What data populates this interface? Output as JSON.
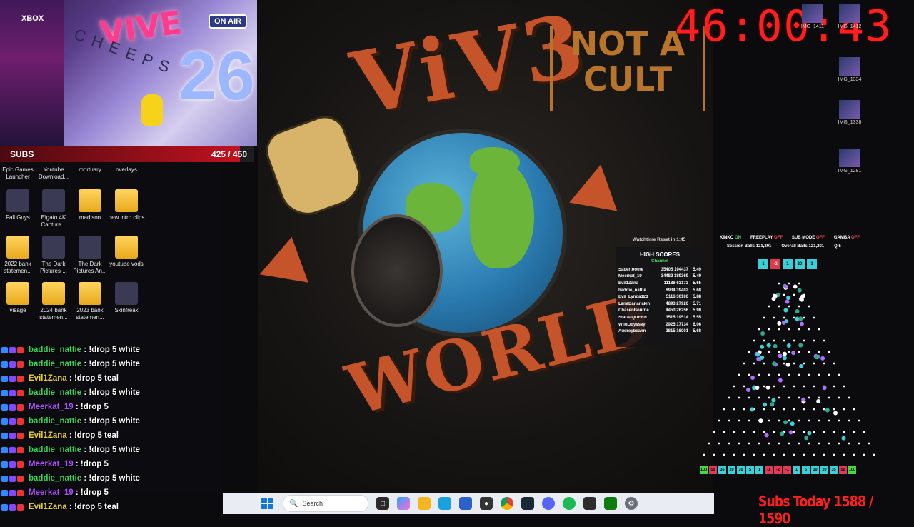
{
  "webcam": {
    "overlay_logo": "VIVE",
    "banner_text": "CHEEPS",
    "balloon_number": "26",
    "on_air": "ON AIR",
    "brand": "XBOX"
  },
  "subs_goal": {
    "label": "SUBS",
    "current": 425,
    "goal": 450,
    "count_text": "425 / 450"
  },
  "desktop_icons": [
    {
      "label": "Epic Games Launcher",
      "line2": "",
      "type": "app"
    },
    {
      "label": "Youtube Download...",
      "type": "app"
    },
    {
      "label": "mortuary",
      "type": "folder"
    },
    {
      "label": "overlays",
      "type": "folder"
    },
    {
      "label": "Fall Guys",
      "type": "app"
    },
    {
      "label": "Elgato 4K Capture...",
      "type": "app"
    },
    {
      "label": "madison",
      "type": "folder"
    },
    {
      "label": "new intro clips",
      "type": "folder"
    },
    {
      "label": "2022 bank statemen...",
      "type": "folder"
    },
    {
      "label": "The Dark Pictures ...",
      "type": "app"
    },
    {
      "label": "The Dark Pictures An...",
      "type": "app"
    },
    {
      "label": "youtube vods",
      "type": "folder"
    },
    {
      "label": "visage",
      "type": "folder"
    },
    {
      "label": "2024 bank statemen...",
      "type": "folder"
    },
    {
      "label": "2023 bank statemen...",
      "type": "folder"
    },
    {
      "label": "Skinfreak",
      "type": "app"
    }
  ],
  "chat": [
    {
      "user": "baddie_nattie",
      "msg": "!drop 5 white",
      "color": "#2fd65a"
    },
    {
      "user": "baddie_nattie",
      "msg": "!drop 5 white",
      "color": "#2fd65a"
    },
    {
      "user": "Evil1Zana",
      "msg": "!drop 5 teal",
      "color": "#e8d12a"
    },
    {
      "user": "baddie_nattie",
      "msg": "!drop 5 white",
      "color": "#2fd65a"
    },
    {
      "user": "Meerkat_19",
      "msg": "!drop 5",
      "color": "#b04dff"
    },
    {
      "user": "baddie_nattie",
      "msg": "!drop 5 white",
      "color": "#2fd65a"
    },
    {
      "user": "Evil1Zana",
      "msg": "!drop 5 teal",
      "color": "#e8d12a"
    },
    {
      "user": "baddie_nattie",
      "msg": "!drop 5 white",
      "color": "#2fd65a"
    },
    {
      "user": "Meerkat_19",
      "msg": "!drop 5",
      "color": "#b04dff"
    },
    {
      "user": "baddie_nattie",
      "msg": "!drop 5 white",
      "color": "#2fd65a"
    },
    {
      "user": "Meerkat_19",
      "msg": "!drop 5",
      "color": "#b04dff"
    },
    {
      "user": "Evil1Zana",
      "msg": "!drop 5 teal",
      "color": "#e8d12a"
    }
  ],
  "album_art": {
    "word_top": "ViV3",
    "word_bottom": "WORLD",
    "tagline_line1": "NOT A",
    "tagline_line2": "CULT"
  },
  "watchtime": "Watchtime Reset in 1:45",
  "highscores": {
    "title": "HIGH SCORES",
    "subtitle": "Channel",
    "rows": [
      {
        "name": "Sabertoothe",
        "score": "35405 194437",
        "avg": "5.49"
      },
      {
        "name": "Meerkat_19",
        "score": "34482 189369",
        "avg": "5.49"
      },
      {
        "name": "Evil1Zana",
        "score": "11186 63173",
        "avg": "5.65"
      },
      {
        "name": "baddie_nattie",
        "score": "6934 39402",
        "avg": "5.68"
      },
      {
        "name": "Evil_Lynda123",
        "score": "5116 30106",
        "avg": "5.88"
      },
      {
        "name": "LanaBananakin",
        "score": "4893 27926",
        "avg": "5.71"
      },
      {
        "name": "ChasenBourne",
        "score": "4450 26256",
        "avg": "5.90"
      },
      {
        "name": "StaraaQUEEN",
        "score": "3515 19514",
        "avg": "5.55"
      },
      {
        "name": "WildOdyssey",
        "score": "2925 17734",
        "avg": "6.06"
      },
      {
        "name": "Audreybeann",
        "score": "2815 16001",
        "avg": "5.68"
      }
    ]
  },
  "timer": "46:00:43",
  "right_icons": [
    {
      "label": "IMG_1411"
    },
    {
      "label": "IMG_1412"
    },
    {
      "label": "IMG_1334"
    },
    {
      "label": "IMG_1338"
    },
    {
      "label": "IMG_1281"
    }
  ],
  "plinko": {
    "modes": [
      {
        "label": "KINKO",
        "state": "ON"
      },
      {
        "label": "FREEPLAY",
        "state": "OFF"
      },
      {
        "label": "SUB MODE",
        "state": "OFF"
      },
      {
        "label": "GAMBA",
        "state": "OFF"
      }
    ],
    "session_balls_label": "Session Balls",
    "session_balls": "121,201",
    "overall_balls_label": "Overall Balls",
    "overall_balls": "121,201",
    "queue_label": "Q",
    "queue": "5",
    "bets": [
      "1",
      "-2",
      "1",
      "20",
      "1"
    ],
    "selected_bet": 1,
    "slots": [
      {
        "v": "100",
        "c": "#46d64a"
      },
      {
        "v": "50",
        "c": "#e0395a"
      },
      {
        "v": "35",
        "c": "#3ad0d8"
      },
      {
        "v": "20",
        "c": "#3ad0d8"
      },
      {
        "v": "10",
        "c": "#3ad0d8"
      },
      {
        "v": "5",
        "c": "#3ad0d8"
      },
      {
        "v": "1",
        "c": "#3ad0d8"
      },
      {
        "v": "-1",
        "c": "#e0395a"
      },
      {
        "v": "-2",
        "c": "#e0395a"
      },
      {
        "v": "-1",
        "c": "#e0395a"
      },
      {
        "v": "1",
        "c": "#3ad0d8"
      },
      {
        "v": "5",
        "c": "#3ad0d8"
      },
      {
        "v": "10",
        "c": "#3ad0d8"
      },
      {
        "v": "20",
        "c": "#3ad0d8"
      },
      {
        "v": "35",
        "c": "#3ad0d8"
      },
      {
        "v": "50",
        "c": "#e0395a"
      },
      {
        "v": "100",
        "c": "#46d64a"
      }
    ]
  },
  "taskbar": {
    "search_placeholder": "Search"
  },
  "subs_today": "Subs Today 1588 / 1590"
}
